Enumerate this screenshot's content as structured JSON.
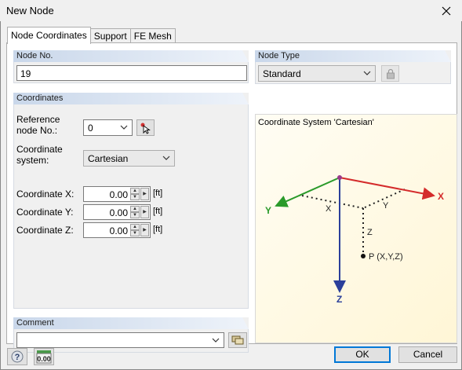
{
  "window": {
    "title": "New Node"
  },
  "tabs": [
    {
      "label": "Node Coordinates",
      "active": true
    },
    {
      "label": "Support",
      "active": false
    },
    {
      "label": "FE Mesh",
      "active": false
    }
  ],
  "node_no": {
    "header": "Node No.",
    "value": "19"
  },
  "node_type": {
    "header": "Node Type",
    "selected": "Standard"
  },
  "coordinates": {
    "header": "Coordinates",
    "reference_label": "Reference\nnode No.:",
    "reference_value": "0",
    "system_label": "Coordinate\nsystem:",
    "system_value": "Cartesian",
    "x_label": "Coordinate X:",
    "x_value": "0.00",
    "y_label": "Coordinate Y:",
    "y_value": "0.00",
    "z_label": "Coordinate Z:",
    "z_value": "0.00",
    "unit": "[ft]"
  },
  "comment": {
    "header": "Comment",
    "value": ""
  },
  "preview": {
    "title": "Coordinate System 'Cartesian'",
    "axis_x": "X",
    "axis_y": "Y",
    "axis_z": "Z",
    "dim_x": "X",
    "dim_y": "Y",
    "dim_z": "Z",
    "point_label": "P (X,Y,Z)"
  },
  "footer": {
    "ok": "OK",
    "cancel": "Cancel",
    "units_icon_text": "0.00"
  },
  "colors": {
    "x_axis": "#d42b2b",
    "y_axis": "#2a9a2a",
    "z_axis": "#2b3f9a",
    "header_grad_start": "#c9d7ea"
  }
}
